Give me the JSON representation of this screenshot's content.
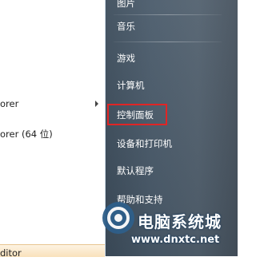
{
  "left_list": {
    "items": [
      {
        "label": "orer",
        "has_submenu": true
      },
      {
        "label": "orer (64 位)",
        "has_submenu": false
      },
      {
        "label": "ditor",
        "has_submenu": false
      }
    ]
  },
  "right_menu": {
    "items": [
      {
        "label": "图片"
      },
      {
        "label": "音乐"
      },
      {
        "label": "游戏"
      },
      {
        "label": "计算机"
      },
      {
        "label": "控制面板",
        "highlighted": true
      },
      {
        "label": "设备和打印机"
      },
      {
        "label": "默认程序"
      },
      {
        "label": "帮助和支持"
      }
    ]
  },
  "watermark": {
    "title": "电脑系统城",
    "url": "www.dnxtc.net"
  },
  "colors": {
    "pane_dark": "#46525e",
    "highlight_border": "#e02525",
    "watermark_blue": "#2f5f8a"
  }
}
